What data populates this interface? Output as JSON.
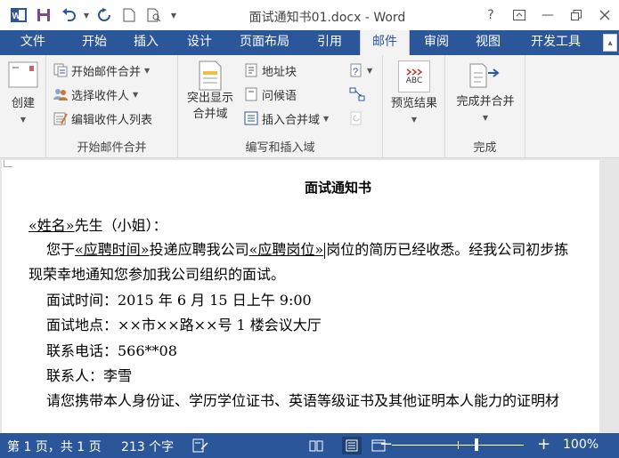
{
  "window": {
    "title": "面试通知书01.docx - Word",
    "help_label": "?",
    "min_label": "—"
  },
  "tabs": [
    {
      "label": "文件"
    },
    {
      "label": "开始"
    },
    {
      "label": "插入"
    },
    {
      "label": "设计"
    },
    {
      "label": "页面布局"
    },
    {
      "label": "引用"
    },
    {
      "label": "邮件"
    },
    {
      "label": "审阅"
    },
    {
      "label": "视图"
    },
    {
      "label": "开发工具"
    }
  ],
  "ribbon": {
    "create_label": "创建",
    "start_group": {
      "label": "开始邮件合并",
      "start_merge": "开始邮件合并",
      "select_recipients": "选择收件人",
      "edit_list": "编辑收件人列表"
    },
    "write_group": {
      "label": "编写和插入域",
      "highlight_fields_line1": "突出显示",
      "highlight_fields_line2": "合并域",
      "address_block": "地址块",
      "greeting_line": "问候语",
      "insert_merge_field": "插入合并域"
    },
    "preview_group": {
      "label": "",
      "preview_results": "预览结果",
      "abc_icon_text": "ABC"
    },
    "finish_group": {
      "label": "完成",
      "finish_merge": "完成并合并"
    }
  },
  "document": {
    "title": "面试通知书",
    "greeting_field": "«姓名»",
    "greeting_rest": "先生（小姐）：",
    "p1_start": "您于",
    "p1_field1": "«应聘时间»",
    "p1_mid": "投递应聘我公司",
    "p1_field2": "«应聘岗位»",
    "p1_end": "岗位的简历已经收悉。经我公司初步拣",
    "p1_line2": "现荣幸地通知您参加我公司组织的面试。",
    "time_line": "面试时间：2015 年 6 月 15 日上午 9:00",
    "place_line": "面试地点：××市××路××号 1 楼会议大厅",
    "phone_line": "联系电话：566**08",
    "contact_line": "联系人：李雪",
    "bring_line": "请您携带本人身份证、学历学位证书、英语等级证书及其他证明本人能力的证明材"
  },
  "status": {
    "page": "第 1 页，共 1 页",
    "words": "213 个字",
    "zoom": "100%",
    "zoom_level": 1.0
  },
  "colors": {
    "word_blue": "#2b579a",
    "ribbon_bg": "#f3f3f3"
  }
}
